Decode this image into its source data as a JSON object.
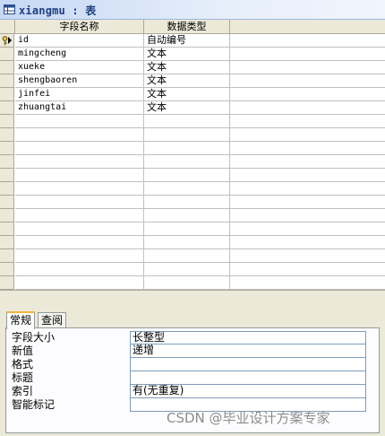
{
  "window": {
    "title": "xiangmu : 表"
  },
  "grid": {
    "columns": [
      "字段名称",
      "数据类型",
      ""
    ],
    "rows": [
      {
        "name": "id",
        "type": "自动编号",
        "key": true
      },
      {
        "name": "mingcheng",
        "type": "文本"
      },
      {
        "name": "xueke",
        "type": "文本"
      },
      {
        "name": "shengbaoren",
        "type": "文本"
      },
      {
        "name": "jinfei",
        "type": "文本"
      },
      {
        "name": "zhuangtai",
        "type": "文本"
      }
    ]
  },
  "properties": {
    "tabs": [
      "常规",
      "查阅"
    ],
    "active_tab": "常规",
    "items": [
      {
        "label": "字段大小",
        "value": "长整型"
      },
      {
        "label": "新值",
        "value": "递增"
      },
      {
        "label": "格式",
        "value": ""
      },
      {
        "label": "标题",
        "value": ""
      },
      {
        "label": "索引",
        "value": "有(无重复)"
      },
      {
        "label": "智能标记",
        "value": ""
      }
    ]
  },
  "watermark": "CSDN @毕业设计方案专家",
  "colors": {
    "title_text": "#1f3f7f",
    "tab_accent": "#f3b63b",
    "grid_line": "#c0c0c0"
  }
}
